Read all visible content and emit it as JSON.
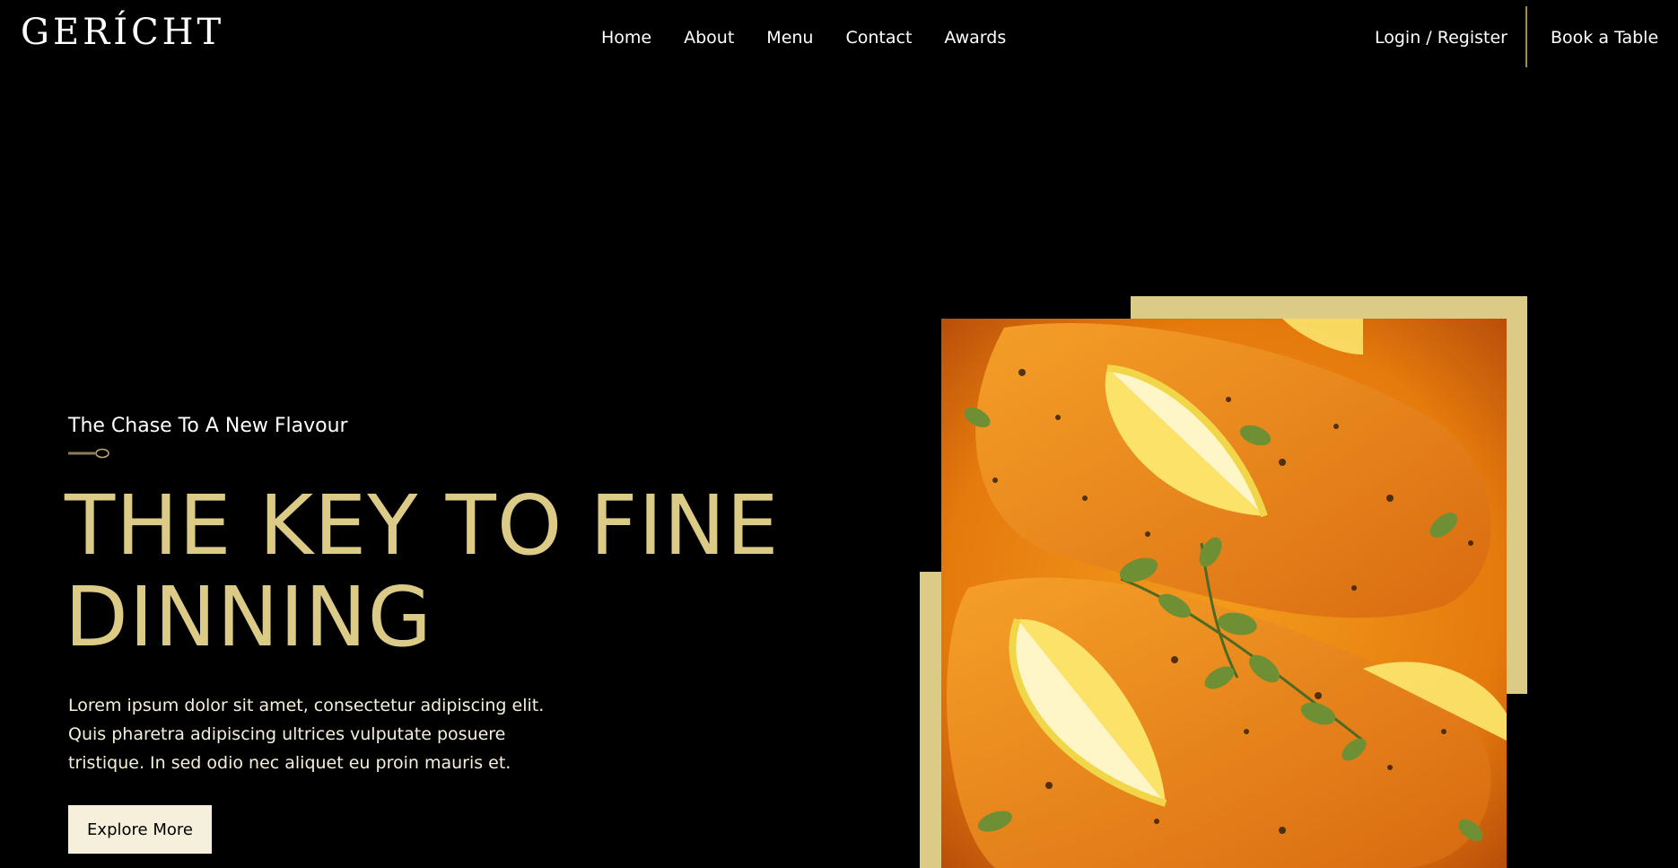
{
  "brand": {
    "logo": "GERÍCHT"
  },
  "nav": {
    "links": [
      "Home",
      "About",
      "Menu",
      "Contact",
      "Awards"
    ],
    "login": "Login / Register",
    "book": "Book a Table"
  },
  "hero": {
    "subtitle": "The Chase To A New Flavour",
    "headline_line1": "THE KEY TO FINE",
    "headline_line2": "DINNING",
    "body": "Lorem ipsum dolor sit amet, consectetur adipiscing elit. Quis pharetra adipiscing ultrices vulputate posuere tristique. In sed odio nec aliquet eu proin mauris et.",
    "cta": "Explore More"
  },
  "colors": {
    "gold": "#dcca87",
    "cream": "#f5efdb",
    "background": "#000000"
  },
  "icons": {
    "spoon": "spoon-icon"
  }
}
